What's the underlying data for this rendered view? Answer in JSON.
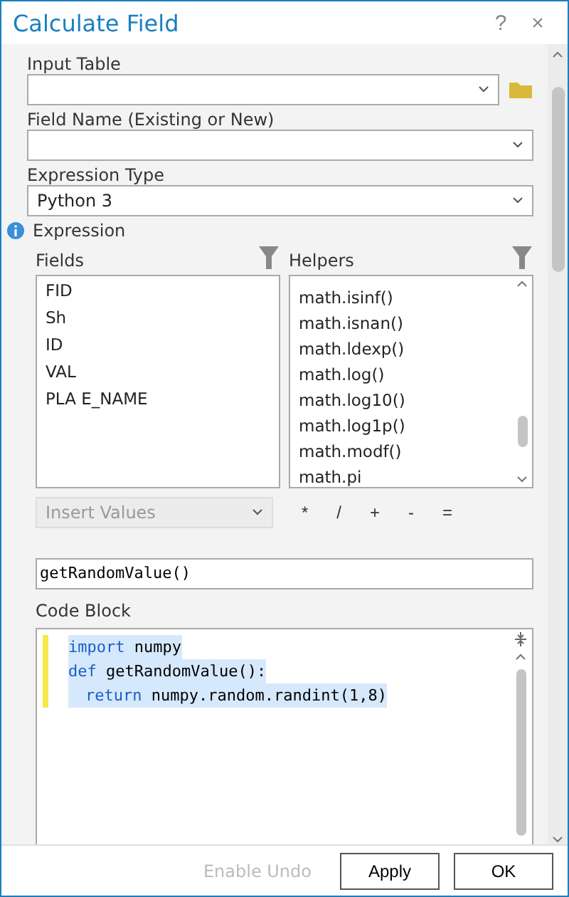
{
  "window": {
    "title": "Calculate Field",
    "help": "?",
    "close": "×"
  },
  "input_table": {
    "label": "Input Table"
  },
  "field_name": {
    "label": "Field Name (Existing or New)"
  },
  "expression_type": {
    "label": "Expression Type",
    "value": "Python 3"
  },
  "expression": {
    "label": "Expression",
    "fields_label": "Fields",
    "helpers_label": "Helpers",
    "fields": [
      "FID",
      "Sh",
      "ID",
      "VAL",
      "PLA  E_NAME"
    ],
    "helpers": [
      "math.isinf()",
      "math.isnan()",
      "math.ldexp()",
      "math.log()",
      "math.log10()",
      "math.log1p()",
      "math.modf()",
      "math.pi"
    ],
    "insert_values": {
      "placeholder": "Insert Values",
      "disabled": true
    },
    "operators": [
      "*",
      "/",
      "+",
      "-",
      "="
    ],
    "value": "getRandomValue()"
  },
  "code_block": {
    "label": "Code Block",
    "lines": [
      {
        "indent": false,
        "keyword": "import",
        "rest": " numpy"
      },
      {
        "indent": false,
        "keyword": "def",
        "rest": " getRandomValue():"
      },
      {
        "indent": true,
        "keyword": "return",
        "rest": " numpy.random.randint(1,8)"
      }
    ]
  },
  "footer": {
    "enable_undo": "Enable Undo",
    "buttons": [
      "Apply",
      "OK"
    ]
  }
}
